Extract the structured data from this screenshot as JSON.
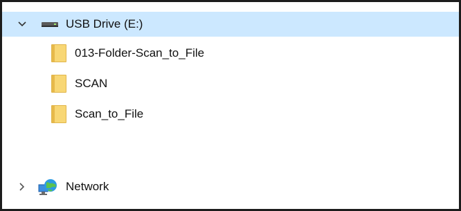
{
  "tree": {
    "drive": {
      "label": "USB Drive (E:)",
      "expanded": true,
      "icon": "usb-drive-icon",
      "selected": true,
      "children": [
        {
          "label": "013-Folder-Scan_to_File",
          "icon": "folder-icon"
        },
        {
          "label": "SCAN",
          "icon": "folder-icon"
        },
        {
          "label": "Scan_to_File",
          "icon": "folder-icon"
        }
      ]
    },
    "network": {
      "label": "Network",
      "expanded": false,
      "icon": "network-icon"
    }
  },
  "colors": {
    "selection": "#cce8ff",
    "folder": "#f8d775",
    "border": "#1c1c1c"
  }
}
